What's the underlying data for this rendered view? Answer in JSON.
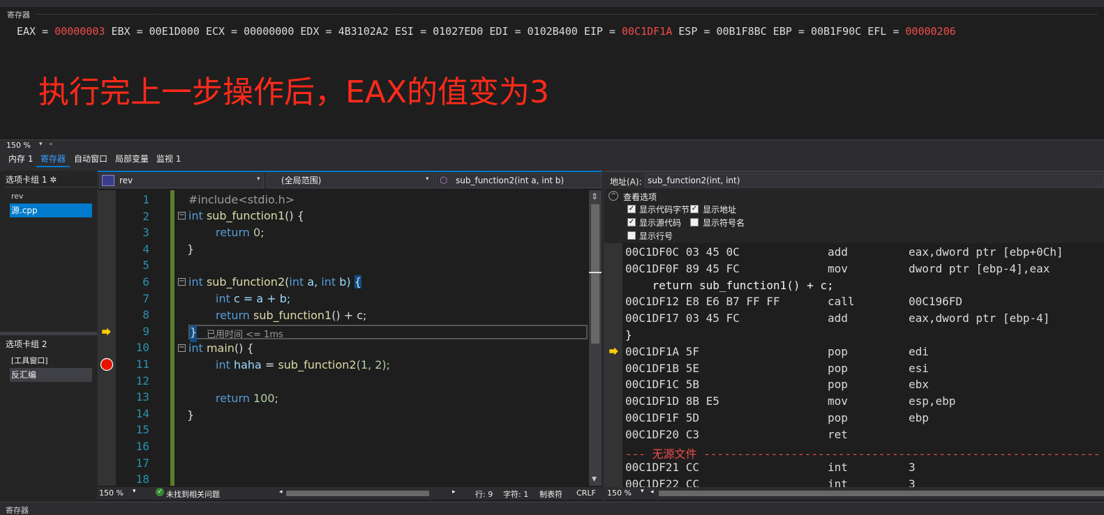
{
  "registers": {
    "title": "寄存器",
    "items": [
      {
        "name": "EAX",
        "value": "00000003",
        "changed": true
      },
      {
        "name": "EBX",
        "value": "00E1D000",
        "changed": false
      },
      {
        "name": "ECX",
        "value": "00000000",
        "changed": false
      },
      {
        "name": "EDX",
        "value": "4B3102A2",
        "changed": false
      },
      {
        "name": "ESI",
        "value": "01027ED0",
        "changed": false
      },
      {
        "name": "EDI",
        "value": "0102B400",
        "changed": false
      },
      {
        "name": "EIP",
        "value": "00C1DF1A",
        "changed": true
      },
      {
        "name": "ESP",
        "value": "00B1F8BC",
        "changed": false
      },
      {
        "name": "EBP",
        "value": "00B1F90C",
        "changed": false
      },
      {
        "name": "EFL",
        "value": "00000206",
        "changed": true
      }
    ],
    "annotation": "执行完上一步操作后，EAX的值变为3",
    "zoom": "150 %"
  },
  "tabs": [
    "内存 1",
    "寄存器",
    "自动窗口",
    "局部变量",
    "监视 1"
  ],
  "active_tab": "寄存器",
  "sidebar": {
    "group1": {
      "title": "选项卡组 1 ✲",
      "items": [
        "rev",
        "源.cpp"
      ]
    },
    "group2": {
      "title": "选项卡组 2",
      "items": [
        "[工具窗口]",
        "反汇编"
      ]
    }
  },
  "editor": {
    "project": "rev",
    "scope": "(全局范围)",
    "function": "sub_function2(int a, int b)",
    "line_numbers": [
      "1",
      "2",
      "3",
      "4",
      "5",
      "6",
      "7",
      "8",
      "9",
      "10",
      "11",
      "12",
      "13",
      "14",
      "15",
      "16",
      "17",
      "18"
    ],
    "perf_tip": "已用时间 <= 1ms",
    "status": {
      "zoom": "150 %",
      "issues": "未找到相关问题",
      "line": "行: 9",
      "char": "字符: 1",
      "tabs": "制表符",
      "eol": "CRLF"
    },
    "code": {
      "l1": "#include<stdio.h>",
      "l2_kw": "int",
      "l2_fn": "sub_function1",
      "l2_rest": "() {",
      "l3_kw": "return",
      "l3_rest": "0;",
      "l4": "}",
      "l6_kw": "int",
      "l6_fn": "sub_function2",
      "l6_p1": "(",
      "l6_t1": "int",
      "l6_a": "a,",
      "l6_t2": "int",
      "l6_b": "b)",
      "l6_brace": "{",
      "l7_kw": "int",
      "l7_rest": "c = a + b;",
      "l8_kw": "return",
      "l8_fn": "sub_function1",
      "l8_rest": "() + c;",
      "l9": "}",
      "l10_kw": "int",
      "l10_fn": "main",
      "l10_rest": "() {",
      "l11_kw": "int",
      "l11_var": "haha",
      "l11_eq": "=",
      "l11_fn": "sub_function2",
      "l11_rest": "(1, 2);",
      "l13_kw": "return",
      "l13_rest": "100;",
      "l14": "}"
    }
  },
  "disassembly": {
    "address_label": "地址(A):",
    "address_value": "sub_function2(int, int)",
    "options_title": "查看选项",
    "options": [
      {
        "label": "显示代码字节",
        "checked": true
      },
      {
        "label": "显示地址",
        "checked": true
      },
      {
        "label": "显示源代码",
        "checked": true
      },
      {
        "label": "显示符号名",
        "checked": false
      },
      {
        "label": "显示行号",
        "checked": false
      }
    ],
    "lines": [
      {
        "addr": "00C1DF0C 03 45 0C",
        "mnem": "add",
        "ops": "eax,dword ptr [ebp+0Ch]"
      },
      {
        "addr": "00C1DF0F 89 45 FC",
        "mnem": "mov",
        "ops": "dword ptr [ebp-4],eax"
      },
      {
        "src": "    return sub_function1() + c;"
      },
      {
        "addr": "00C1DF12 E8 E6 B7 FF FF",
        "mnem": "call",
        "ops": "00C196FD"
      },
      {
        "addr": "00C1DF17 03 45 FC",
        "mnem": "add",
        "ops": "eax,dword ptr [ebp-4]"
      },
      {
        "src": "}"
      },
      {
        "addr": "00C1DF1A 5F",
        "mnem": "pop",
        "ops": "edi"
      },
      {
        "addr": "00C1DF1B 5E",
        "mnem": "pop",
        "ops": "esi"
      },
      {
        "addr": "00C1DF1C 5B",
        "mnem": "pop",
        "ops": "ebx"
      },
      {
        "addr": "00C1DF1D 8B E5",
        "mnem": "mov",
        "ops": "esp,ebp"
      },
      {
        "addr": "00C1DF1F 5D",
        "mnem": "pop",
        "ops": "ebp"
      },
      {
        "addr": "00C1DF20 C3",
        "mnem": "ret",
        "ops": ""
      },
      {
        "nosrc": "--- 无源文件 ---------------------------------------------------------------------"
      },
      {
        "addr": "00C1DF21 CC",
        "mnem": "int",
        "ops": "3"
      },
      {
        "addr": "00C1DF22 CC",
        "mnem": "int",
        "ops": "3"
      }
    ],
    "zoom": "150 %"
  },
  "bottom_label": "寄存器",
  "colors": {
    "accent": "#007acc",
    "changed": "#f14c4c",
    "annotation": "#ff2a1a",
    "breakpoint": "#e51400",
    "arrow": "#ffcc00"
  }
}
